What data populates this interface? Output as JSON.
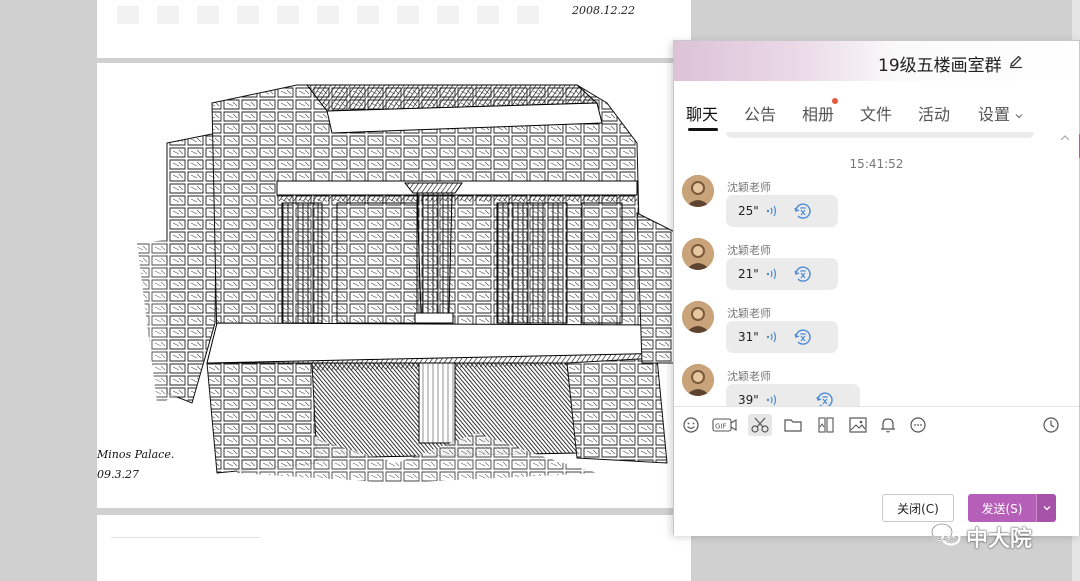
{
  "document": {
    "top_page_date": "2008.12.22",
    "sketch_caption": "Minos Palace.",
    "sketch_date": "09.3.27"
  },
  "chat": {
    "title": "19级五楼画室群",
    "tabs": [
      {
        "label": "聊天",
        "active": true
      },
      {
        "label": "公告"
      },
      {
        "label": "相册",
        "has_dot": true
      },
      {
        "label": "文件"
      },
      {
        "label": "活动"
      },
      {
        "label": "设置"
      }
    ],
    "timestamp": "15:41:52",
    "messages": [
      {
        "sender": "沈颖老师",
        "duration": "25\""
      },
      {
        "sender": "沈颖老师",
        "duration": "21\""
      },
      {
        "sender": "沈颖老师",
        "duration": "31\""
      },
      {
        "sender": "沈颖老师",
        "duration": "39\""
      }
    ],
    "toolbar": [
      "emoji-icon",
      "gif-icon",
      "scissors-icon",
      "folder-icon",
      "image-text-icon",
      "picture-icon",
      "bell-icon",
      "more-icon",
      "history-icon"
    ],
    "close_button": "关闭(C)",
    "send_button": "发送(S)",
    "accent_color": "#b65fb8"
  },
  "watermark": {
    "text": "中大院"
  }
}
